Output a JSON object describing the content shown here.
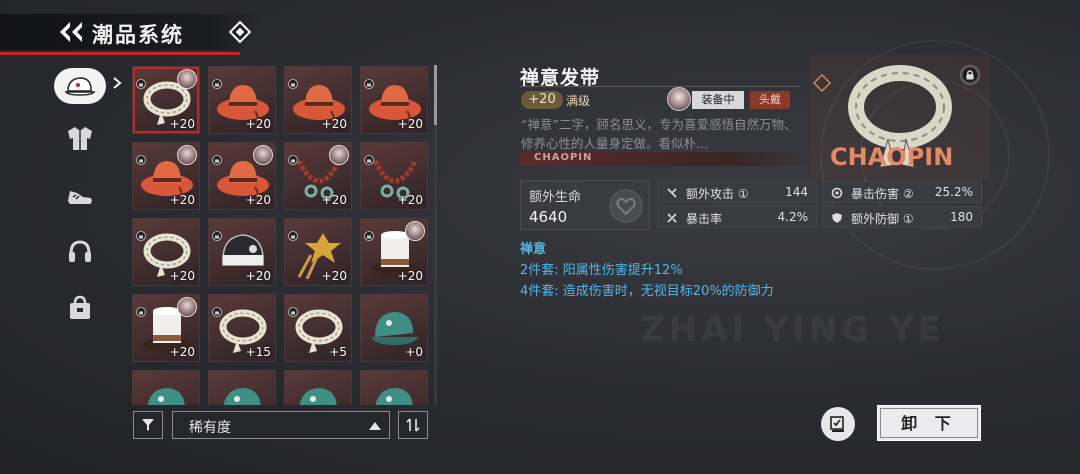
{
  "header": {
    "title": "潮品系统"
  },
  "sidebar": {
    "items": [
      {
        "icon": "cap-icon",
        "active": true
      },
      {
        "icon": "jacket-icon",
        "active": false
      },
      {
        "icon": "shoes-icon",
        "active": false
      },
      {
        "icon": "headphones-icon",
        "active": false
      },
      {
        "icon": "bag-icon",
        "active": false
      }
    ]
  },
  "grid": {
    "items": [
      {
        "type": "headband",
        "level": "+20",
        "locked": true,
        "avatar": true,
        "selected": true
      },
      {
        "type": "red-hat",
        "level": "+20",
        "locked": true,
        "avatar": false
      },
      {
        "type": "red-hat",
        "level": "+20",
        "locked": true,
        "avatar": false
      },
      {
        "type": "red-hat",
        "level": "+20",
        "locked": true,
        "avatar": false
      },
      {
        "type": "red-hat",
        "level": "+20",
        "locked": true,
        "avatar": true
      },
      {
        "type": "red-hat",
        "level": "+20",
        "locked": true,
        "avatar": true
      },
      {
        "type": "beads",
        "level": "+20",
        "locked": true,
        "avatar": true
      },
      {
        "type": "beads",
        "level": "+20",
        "locked": true,
        "avatar": false
      },
      {
        "type": "headband",
        "level": "+20",
        "locked": true,
        "avatar": false
      },
      {
        "type": "helmet",
        "level": "+20",
        "locked": true,
        "avatar": false
      },
      {
        "type": "hairpin",
        "level": "+20",
        "locked": true,
        "avatar": false
      },
      {
        "type": "tophat",
        "level": "+20",
        "locked": true,
        "avatar": true
      },
      {
        "type": "tophat",
        "level": "+20",
        "locked": true,
        "avatar": true
      },
      {
        "type": "headband",
        "level": "+15",
        "locked": true,
        "avatar": false
      },
      {
        "type": "headband",
        "level": "+5",
        "locked": true,
        "avatar": false
      },
      {
        "type": "green-cap",
        "level": "+0",
        "locked": false,
        "avatar": false
      },
      {
        "type": "green-cap",
        "level": "",
        "locked": false,
        "avatar": false
      },
      {
        "type": "green-cap",
        "level": "",
        "locked": false,
        "avatar": false
      },
      {
        "type": "green-cap",
        "level": "",
        "locked": false,
        "avatar": false
      },
      {
        "type": "green-cap",
        "level": "",
        "locked": false,
        "avatar": false
      }
    ]
  },
  "sort": {
    "label": "稀有度"
  },
  "detail": {
    "name": "禅意发带",
    "level": "+20",
    "max_label": "满级",
    "equipped_label": "装备中",
    "slot_label": "头戴",
    "description": "“禅意”二字，顾名思义，专为喜爱感悟自然万物、修养心性的人量身定做。看似朴…",
    "strip_text": "CHAOPIN",
    "art_text": "CHAOPIN",
    "main_stat": {
      "label": "额外生命",
      "value": "4640"
    },
    "stats": [
      {
        "icon": "attack-icon",
        "label": "额外攻击 ①",
        "value": "144"
      },
      {
        "icon": "crit-damage-icon",
        "label": "暴击伤害 ②",
        "value": "25.2%"
      },
      {
        "icon": "crit-rate-icon",
        "label": "暴击率",
        "value": "4.2%"
      },
      {
        "icon": "defense-icon",
        "label": "额外防御 ①",
        "value": "180"
      }
    ],
    "set_title": "禅意",
    "set_bonuses": [
      "2件套: 阳属性伤害提升12%",
      "4件套: 造成伤害时，无视目标20%的防御力"
    ]
  },
  "actions": {
    "unequip_label": "卸 下"
  },
  "colors": {
    "accent_red": "#c2262b",
    "set_blue": "#4fb7e8",
    "level_gold": "#6b5a3c"
  }
}
